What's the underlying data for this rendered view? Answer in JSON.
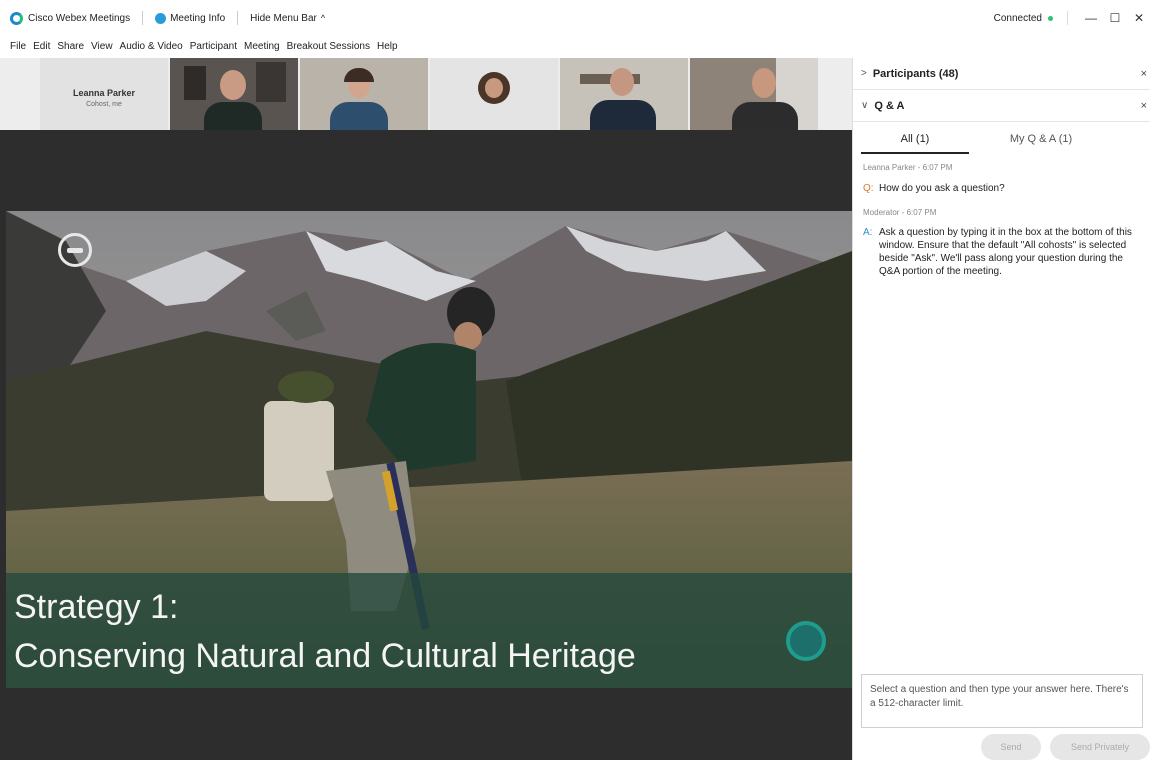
{
  "titlebar": {
    "app_name": "Cisco Webex Meetings",
    "meeting_info": "Meeting Info",
    "hide_menu_bar": "Hide Menu Bar",
    "hide_menu_caret": "^",
    "status": "Connected",
    "minimize": "—",
    "maximize": "☐",
    "close": "✕"
  },
  "menubar": {
    "items": [
      "File",
      "Edit",
      "Share",
      "View",
      "Audio & Video",
      "Participant",
      "Meeting",
      "Breakout Sessions",
      "Help"
    ]
  },
  "video_strip": {
    "name_tile": {
      "name": "Leanna Parker",
      "subtitle": "Cohost, me"
    }
  },
  "slide": {
    "line1": "Strategy 1:",
    "line2": "Conserving Natural and Cultural Heritage"
  },
  "panel": {
    "participants": {
      "chevron": ">",
      "title": "Participants (48)",
      "close": "×"
    },
    "qa": {
      "chevron": "∨",
      "title": "Q & A",
      "close": "×"
    },
    "tabs": {
      "all": "All (1)",
      "mine": "My Q & A (1)"
    },
    "question": {
      "meta": "Leanna Parker - 6:07 PM",
      "prefix": "Q:",
      "text": "How do you ask a question?"
    },
    "answer": {
      "meta": "Moderator - 6:07 PM",
      "prefix": "A:",
      "text": "Ask a question by typing it in the box at the bottom of this window. Ensure that the default \"All cohosts\" is selected beside \"Ask\". We'll pass along your question during the Q&A portion of the meeting."
    },
    "answer_input": {
      "placeholder": "Select a question and then type your answer here. There's a 512-character limit."
    },
    "buttons": {
      "send": "Send",
      "send_privately": "Send Privately"
    }
  },
  "colors": {
    "accent_blue": "#2b9bd8",
    "connected_green": "#2ec26f",
    "question_orange": "#e0782a",
    "answer_blue": "#2a8fd4",
    "caption_band": "#24483c"
  }
}
